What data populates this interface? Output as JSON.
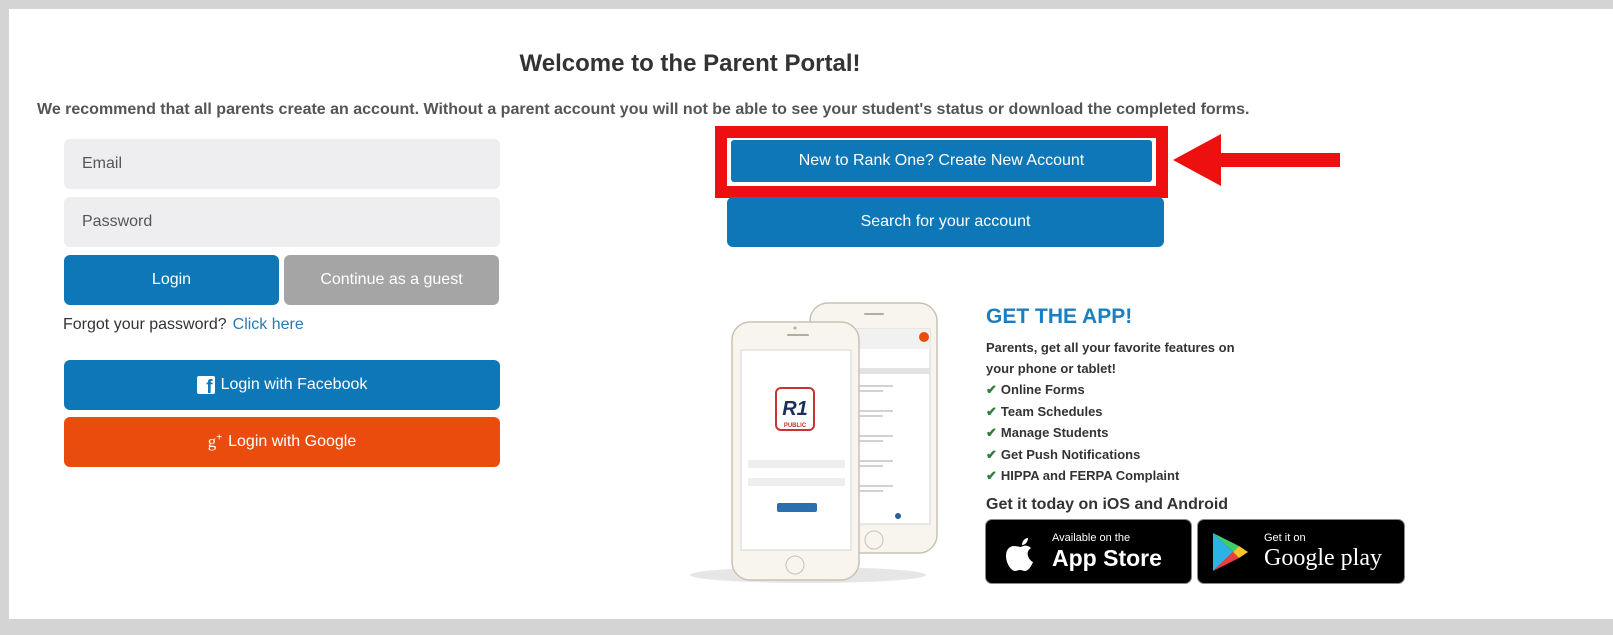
{
  "page": {
    "title": "Welcome to the Parent Portal!",
    "intro": "We recommend that all parents create an account. Without a parent account you will not be able to see your student's status or download the completed forms."
  },
  "login": {
    "email_placeholder": "Email",
    "password_placeholder": "Password",
    "login_label": "Login",
    "guest_label": "Continue as a guest",
    "forgot_text": "Forgot your password?",
    "forgot_link": "Click here",
    "facebook_label": "Login with Facebook",
    "google_label": "Login with Google"
  },
  "account": {
    "create_label": "New to Rank One? Create New Account",
    "search_label": "Search for your account"
  },
  "app": {
    "heading": "GET THE APP!",
    "description": "Parents, get all your favorite features on your phone or tablet!",
    "features": [
      "Online Forms",
      "Team Schedules",
      "Manage Students",
      "Get Push Notifications",
      "HIPPA and FERPA Complaint"
    ],
    "get_it": "Get it today on iOS and Android",
    "appstore_small": "Available on the",
    "appstore_big": "App Store",
    "googleplay_small": "Get it on",
    "googleplay_big": "Google play"
  },
  "colors": {
    "primary": "#0d77b8",
    "guest": "#a5a5a5",
    "google": "#e94c0d",
    "highlight": "#ee1010",
    "app_heading": "#1a7fc0"
  },
  "icons": {
    "facebook": "facebook-icon",
    "google": "google-plus-icon",
    "check": "check-icon",
    "arrow": "red-arrow-icon",
    "apple": "apple-icon",
    "play": "google-play-icon"
  }
}
